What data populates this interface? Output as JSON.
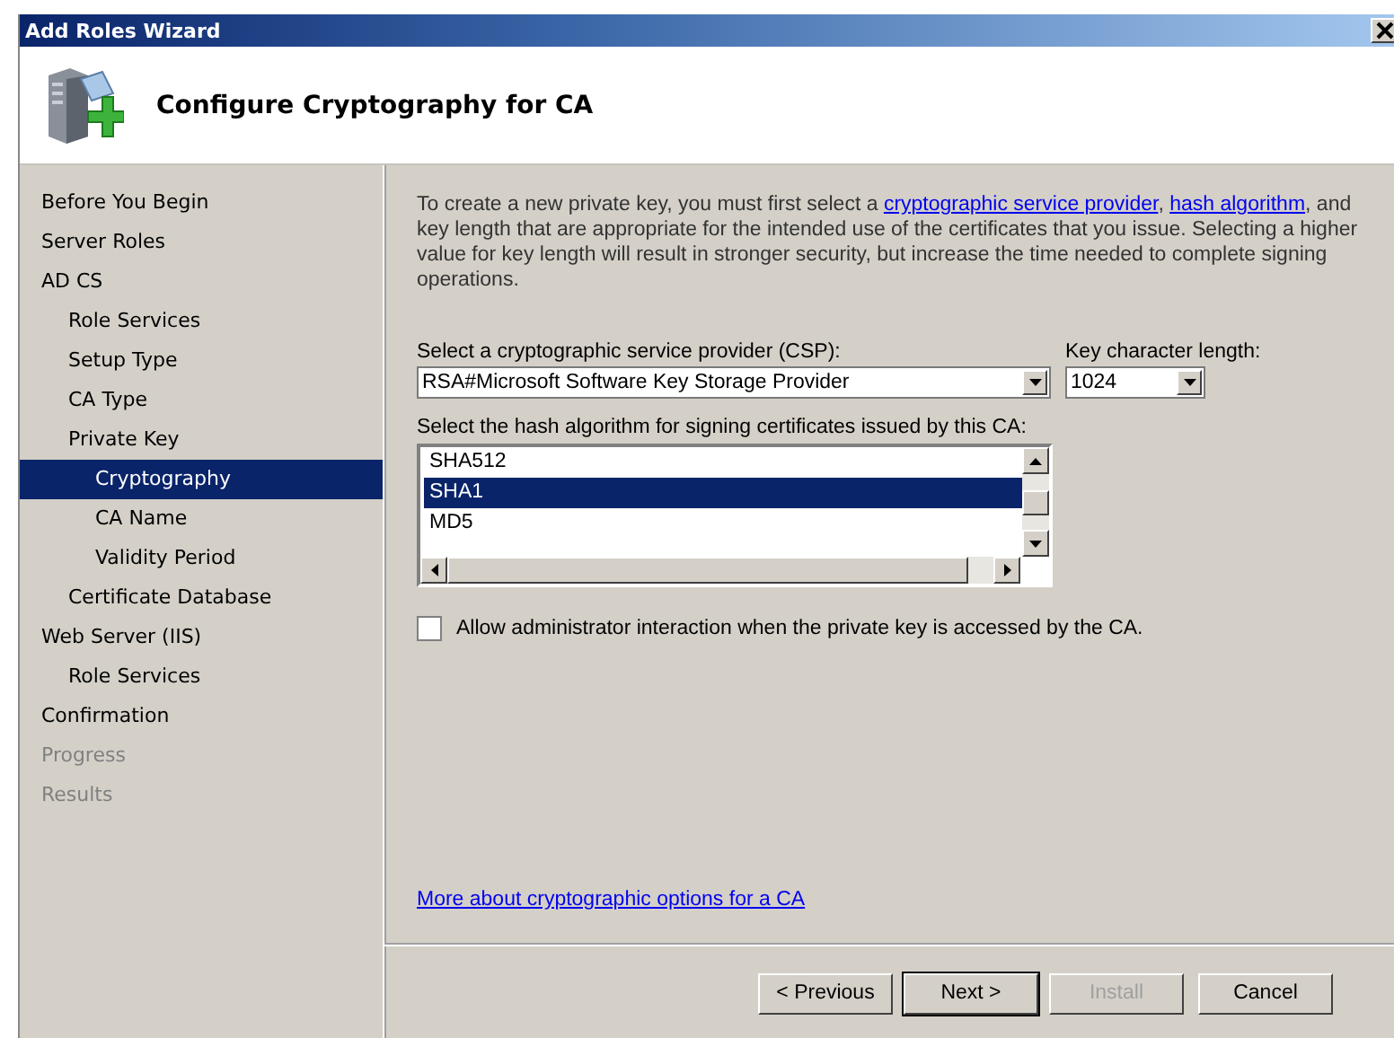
{
  "window": {
    "title": "Add Roles Wizard"
  },
  "header": {
    "title": "Configure Cryptography for CA"
  },
  "sidebar": {
    "items": [
      {
        "label": "Before You Begin",
        "selected": false,
        "disabled": false
      },
      {
        "label": "Server Roles",
        "selected": false,
        "disabled": false
      },
      {
        "label": "AD CS",
        "selected": false,
        "disabled": false,
        "children": [
          {
            "label": "Role Services",
            "selected": false,
            "disabled": false
          },
          {
            "label": "Setup Type",
            "selected": false,
            "disabled": false
          },
          {
            "label": "CA Type",
            "selected": false,
            "disabled": false
          },
          {
            "label": "Private Key",
            "selected": false,
            "disabled": false,
            "children": [
              {
                "label": "Cryptography",
                "selected": true,
                "disabled": false
              },
              {
                "label": "CA Name",
                "selected": false,
                "disabled": false
              },
              {
                "label": "Validity Period",
                "selected": false,
                "disabled": false
              }
            ]
          },
          {
            "label": "Certificate Database",
            "selected": false,
            "disabled": false
          }
        ]
      },
      {
        "label": "Web Server (IIS)",
        "selected": false,
        "disabled": false,
        "children": [
          {
            "label": "Role Services",
            "selected": false,
            "disabled": false
          }
        ]
      },
      {
        "label": "Confirmation",
        "selected": false,
        "disabled": false
      },
      {
        "label": "Progress",
        "selected": false,
        "disabled": true
      },
      {
        "label": "Results",
        "selected": false,
        "disabled": true
      }
    ]
  },
  "description": [
    {
      "kind": "text",
      "text": "To create a new private key, you must first select a "
    },
    {
      "kind": "link",
      "text": "cryptographic service provider"
    },
    {
      "kind": "text",
      "text": ", "
    },
    {
      "kind": "link",
      "text": "hash algorithm"
    },
    {
      "kind": "text",
      "text": ", and key length that are appropriate for the intended use of the certificates that you issue. Selecting a higher value for key length will result in stronger security, but increase the time needed to complete signing operations."
    }
  ],
  "csp": {
    "label": "Select a cryptographic service provider (CSP):",
    "value": "RSA#Microsoft Software Key Storage Provider"
  },
  "key_length": {
    "label": "Key character length:",
    "value": "1024"
  },
  "hash": {
    "label": "Select the hash algorithm for signing certificates issued by this CA:",
    "items": [
      {
        "label": "SHA512",
        "selected": false
      },
      {
        "label": "SHA1",
        "selected": true
      },
      {
        "label": "MD5",
        "selected": false
      }
    ]
  },
  "admin_interaction": {
    "label": "Allow administrator interaction when the private key is accessed by the CA.",
    "checked": false
  },
  "more_link": "More about cryptographic options for a CA",
  "buttons": [
    {
      "label": "< Previous",
      "disabled": false,
      "default": false
    },
    {
      "label": "Next >",
      "disabled": false,
      "default": true
    },
    {
      "label": "Install",
      "disabled": true,
      "default": false
    },
    {
      "label": "Cancel",
      "disabled": false,
      "default": false
    }
  ]
}
